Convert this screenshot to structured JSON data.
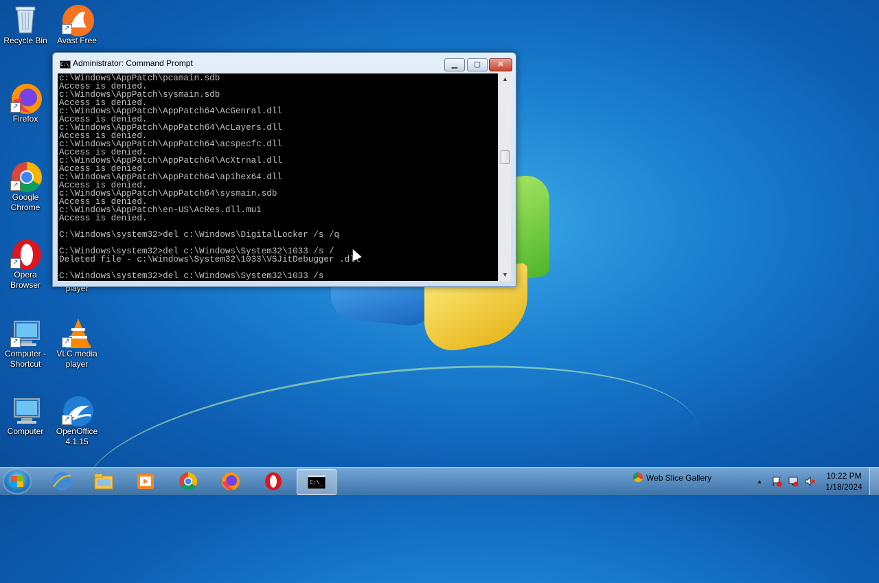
{
  "desktop": {
    "icons": [
      {
        "label": "Recycle Bin"
      },
      {
        "label": "Avast Free"
      },
      {
        "label": "Firefox"
      },
      {
        "label": "Google Chrome"
      },
      {
        "label": "Opera Browser"
      },
      {
        "label": "player"
      },
      {
        "label": "Computer - Shortcut"
      },
      {
        "label": "VLC media player"
      },
      {
        "label": "Computer"
      },
      {
        "label": "OpenOffice 4.1.15"
      }
    ]
  },
  "window": {
    "title": "Administrator: Command Prompt",
    "title_icon_text": "C:\\",
    "minimize": "▁",
    "maximize": "▢",
    "close": "✕",
    "console_text": "c:\\Windows\\AppPatch\\pcamain.sdb\nAccess is denied.\nc:\\Windows\\AppPatch\\sysmain.sdb\nAccess is denied.\nc:\\Windows\\AppPatch\\AppPatch64\\AcGenral.dll\nAccess is denied.\nc:\\Windows\\AppPatch\\AppPatch64\\AcLayers.dll\nAccess is denied.\nc:\\Windows\\AppPatch\\AppPatch64\\acspecfc.dll\nAccess is denied.\nc:\\Windows\\AppPatch\\AppPatch64\\AcXtrnal.dll\nAccess is denied.\nc:\\Windows\\AppPatch\\AppPatch64\\apihex64.dll\nAccess is denied.\nc:\\Windows\\AppPatch\\AppPatch64\\sysmain.sdb\nAccess is denied.\nc:\\Windows\\AppPatch\\en-US\\AcRes.dll.mui\nAccess is denied.\n\nC:\\Windows\\system32>del c:\\Windows\\DigitalLocker /s /q\n\nC:\\Windows\\system32>del c:\\Windows\\System32\\1033 /s /\nDeleted file - c:\\Windows\\System32\\1033\\VSJitDebugger .dll\n\nC:\\Windows\\system32>del c:\\Windows\\System32\\1033 /s",
    "scroll_up": "▲",
    "scroll_down": "▼"
  },
  "taskbar": {
    "web_slice_gallery": "Web Slice Gallery",
    "tray_expand": "▲",
    "time": "10:22 PM",
    "date": "1/18/2024"
  },
  "colors": {
    "desktop_bg": "#1b7fd0",
    "console_bg": "#000000",
    "console_fg": "#c0c0c0",
    "close_button": "#c7432b"
  }
}
